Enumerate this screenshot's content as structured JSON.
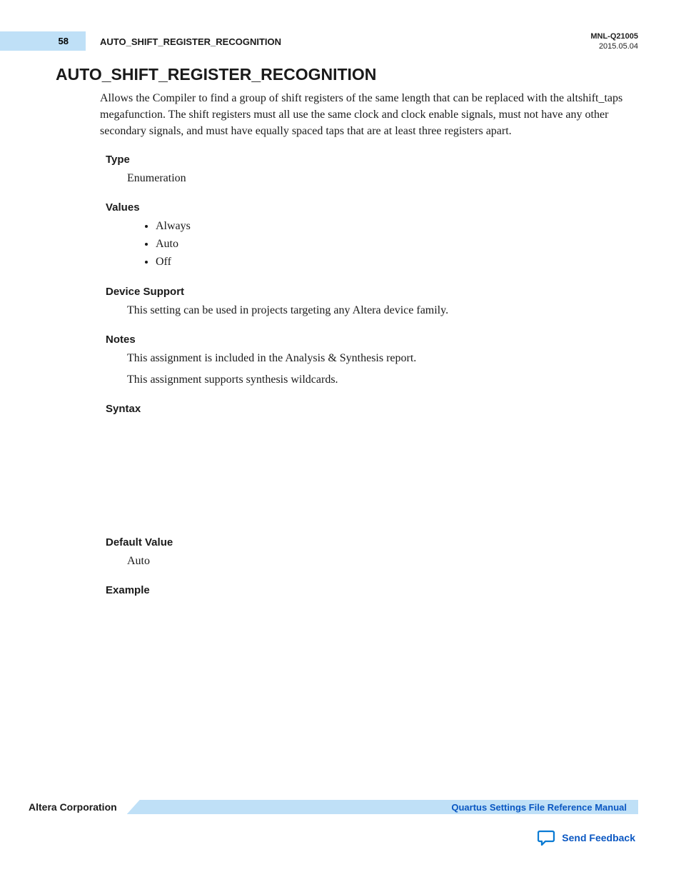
{
  "header": {
    "page_number": "58",
    "running_title": "AUTO_SHIFT_REGISTER_RECOGNITION",
    "doc_id": "MNL-Q21005",
    "doc_date": "2015.05.04"
  },
  "title": "AUTO_SHIFT_REGISTER_RECOGNITION",
  "intro": "Allows the Compiler to find a group of shift registers of the same length that can be replaced with the altshift_taps megafunction. The shift registers must all use the same clock and clock enable signals, must not have any other secondary signals, and must have equally spaced taps that are at least three registers apart.",
  "sections": {
    "type": {
      "label": "Type",
      "value": "Enumeration"
    },
    "values": {
      "label": "Values",
      "items": [
        "Always",
        "Auto",
        "Off"
      ]
    },
    "device_support": {
      "label": "Device Support",
      "value": "This setting can be used in projects targeting any Altera device family."
    },
    "notes": {
      "label": "Notes",
      "lines": [
        "This assignment is included in the Analysis & Synthesis report.",
        "This assignment supports synthesis wildcards."
      ]
    },
    "syntax": {
      "label": "Syntax"
    },
    "default_value": {
      "label": "Default Value",
      "value": "Auto"
    },
    "example": {
      "label": "Example"
    }
  },
  "footer": {
    "corporation": "Altera Corporation",
    "manual_link": "Quartus Settings File Reference Manual",
    "feedback": "Send Feedback"
  }
}
